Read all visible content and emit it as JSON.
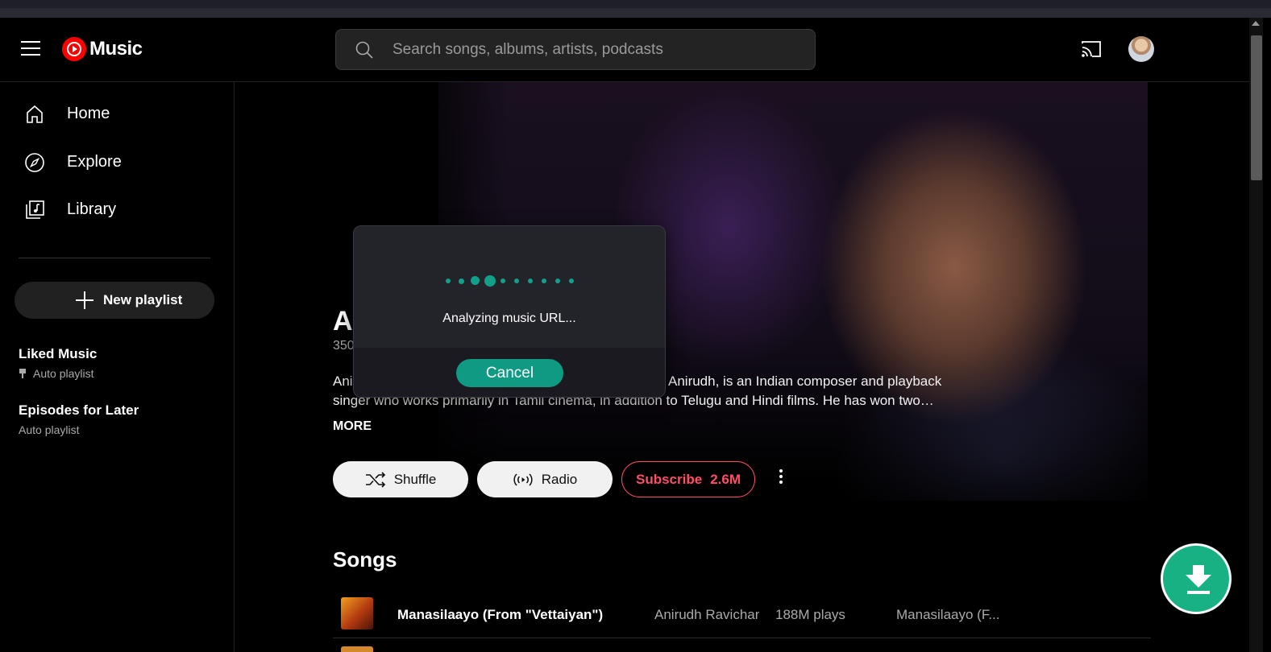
{
  "header": {
    "logo_text": "Music",
    "search_placeholder": "Search songs, albums, artists, podcasts"
  },
  "sidebar": {
    "nav": [
      {
        "label": "Home",
        "icon": "home-icon"
      },
      {
        "label": "Explore",
        "icon": "compass-icon"
      },
      {
        "label": "Library",
        "icon": "library-icon"
      }
    ],
    "new_playlist_label": "New playlist",
    "playlists": [
      {
        "title": "Liked Music",
        "subtitle": "Auto playlist",
        "pinned": true
      },
      {
        "title": "Episodes for Later",
        "subtitle": "Auto playlist",
        "pinned": false
      }
    ]
  },
  "artist": {
    "name_visible": "Ar",
    "subscribers_visible": "350",
    "bio_line1_left": "Ani",
    "bio_line1_right": "Anirudh, is an Indian composer and playback",
    "bio_line2": "singer who works primarily in Tamil cinema, in addition to Telugu and Hindi films. He has won two…",
    "more_label": "MORE",
    "shuffle_label": "Shuffle",
    "radio_label": "Radio",
    "subscribe_label": "Subscribe",
    "subscribe_count": "2.6M"
  },
  "songs": {
    "section_title": "Songs",
    "rows": [
      {
        "title": "Manasilaayo (From \"Vettaiyan\")",
        "artist": "Anirudh Ravichander",
        "plays": "188M plays",
        "album": "Manasilaayo (F..."
      }
    ]
  },
  "dialog": {
    "message": "Analyzing music URL...",
    "cancel_label": "Cancel",
    "accent_color": "#12a08a"
  },
  "colors": {
    "brand_red": "#ff0000",
    "subscribe_red": "#ff4e66",
    "download_green": "#17b184"
  }
}
